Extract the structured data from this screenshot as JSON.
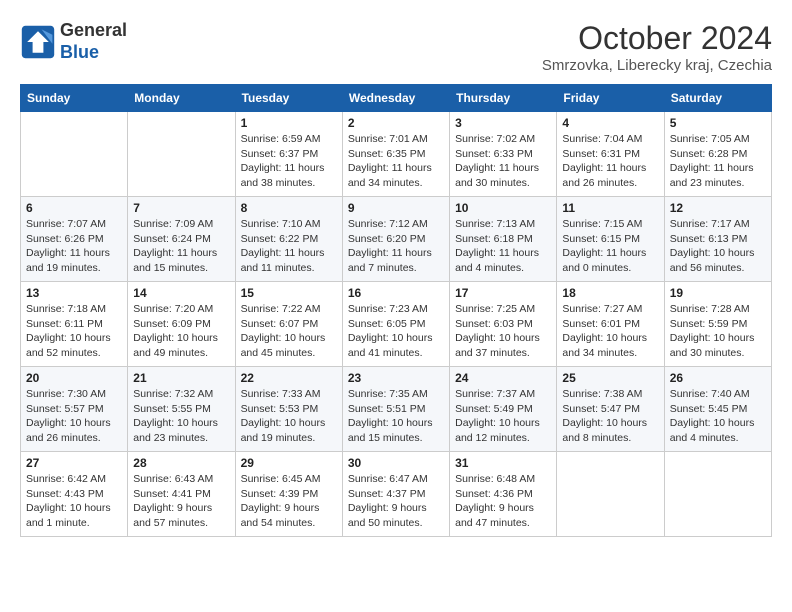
{
  "header": {
    "logo_line1": "General",
    "logo_line2": "Blue",
    "month": "October 2024",
    "location": "Smrzovka, Liberecky kraj, Czechia"
  },
  "weekdays": [
    "Sunday",
    "Monday",
    "Tuesday",
    "Wednesday",
    "Thursday",
    "Friday",
    "Saturday"
  ],
  "weeks": [
    [
      {
        "day": "",
        "info": ""
      },
      {
        "day": "",
        "info": ""
      },
      {
        "day": "1",
        "info": "Sunrise: 6:59 AM\nSunset: 6:37 PM\nDaylight: 11 hours and 38 minutes."
      },
      {
        "day": "2",
        "info": "Sunrise: 7:01 AM\nSunset: 6:35 PM\nDaylight: 11 hours and 34 minutes."
      },
      {
        "day": "3",
        "info": "Sunrise: 7:02 AM\nSunset: 6:33 PM\nDaylight: 11 hours and 30 minutes."
      },
      {
        "day": "4",
        "info": "Sunrise: 7:04 AM\nSunset: 6:31 PM\nDaylight: 11 hours and 26 minutes."
      },
      {
        "day": "5",
        "info": "Sunrise: 7:05 AM\nSunset: 6:28 PM\nDaylight: 11 hours and 23 minutes."
      }
    ],
    [
      {
        "day": "6",
        "info": "Sunrise: 7:07 AM\nSunset: 6:26 PM\nDaylight: 11 hours and 19 minutes."
      },
      {
        "day": "7",
        "info": "Sunrise: 7:09 AM\nSunset: 6:24 PM\nDaylight: 11 hours and 15 minutes."
      },
      {
        "day": "8",
        "info": "Sunrise: 7:10 AM\nSunset: 6:22 PM\nDaylight: 11 hours and 11 minutes."
      },
      {
        "day": "9",
        "info": "Sunrise: 7:12 AM\nSunset: 6:20 PM\nDaylight: 11 hours and 7 minutes."
      },
      {
        "day": "10",
        "info": "Sunrise: 7:13 AM\nSunset: 6:18 PM\nDaylight: 11 hours and 4 minutes."
      },
      {
        "day": "11",
        "info": "Sunrise: 7:15 AM\nSunset: 6:15 PM\nDaylight: 11 hours and 0 minutes."
      },
      {
        "day": "12",
        "info": "Sunrise: 7:17 AM\nSunset: 6:13 PM\nDaylight: 10 hours and 56 minutes."
      }
    ],
    [
      {
        "day": "13",
        "info": "Sunrise: 7:18 AM\nSunset: 6:11 PM\nDaylight: 10 hours and 52 minutes."
      },
      {
        "day": "14",
        "info": "Sunrise: 7:20 AM\nSunset: 6:09 PM\nDaylight: 10 hours and 49 minutes."
      },
      {
        "day": "15",
        "info": "Sunrise: 7:22 AM\nSunset: 6:07 PM\nDaylight: 10 hours and 45 minutes."
      },
      {
        "day": "16",
        "info": "Sunrise: 7:23 AM\nSunset: 6:05 PM\nDaylight: 10 hours and 41 minutes."
      },
      {
        "day": "17",
        "info": "Sunrise: 7:25 AM\nSunset: 6:03 PM\nDaylight: 10 hours and 37 minutes."
      },
      {
        "day": "18",
        "info": "Sunrise: 7:27 AM\nSunset: 6:01 PM\nDaylight: 10 hours and 34 minutes."
      },
      {
        "day": "19",
        "info": "Sunrise: 7:28 AM\nSunset: 5:59 PM\nDaylight: 10 hours and 30 minutes."
      }
    ],
    [
      {
        "day": "20",
        "info": "Sunrise: 7:30 AM\nSunset: 5:57 PM\nDaylight: 10 hours and 26 minutes."
      },
      {
        "day": "21",
        "info": "Sunrise: 7:32 AM\nSunset: 5:55 PM\nDaylight: 10 hours and 23 minutes."
      },
      {
        "day": "22",
        "info": "Sunrise: 7:33 AM\nSunset: 5:53 PM\nDaylight: 10 hours and 19 minutes."
      },
      {
        "day": "23",
        "info": "Sunrise: 7:35 AM\nSunset: 5:51 PM\nDaylight: 10 hours and 15 minutes."
      },
      {
        "day": "24",
        "info": "Sunrise: 7:37 AM\nSunset: 5:49 PM\nDaylight: 10 hours and 12 minutes."
      },
      {
        "day": "25",
        "info": "Sunrise: 7:38 AM\nSunset: 5:47 PM\nDaylight: 10 hours and 8 minutes."
      },
      {
        "day": "26",
        "info": "Sunrise: 7:40 AM\nSunset: 5:45 PM\nDaylight: 10 hours and 4 minutes."
      }
    ],
    [
      {
        "day": "27",
        "info": "Sunrise: 6:42 AM\nSunset: 4:43 PM\nDaylight: 10 hours and 1 minute."
      },
      {
        "day": "28",
        "info": "Sunrise: 6:43 AM\nSunset: 4:41 PM\nDaylight: 9 hours and 57 minutes."
      },
      {
        "day": "29",
        "info": "Sunrise: 6:45 AM\nSunset: 4:39 PM\nDaylight: 9 hours and 54 minutes."
      },
      {
        "day": "30",
        "info": "Sunrise: 6:47 AM\nSunset: 4:37 PM\nDaylight: 9 hours and 50 minutes."
      },
      {
        "day": "31",
        "info": "Sunrise: 6:48 AM\nSunset: 4:36 PM\nDaylight: 9 hours and 47 minutes."
      },
      {
        "day": "",
        "info": ""
      },
      {
        "day": "",
        "info": ""
      }
    ]
  ]
}
